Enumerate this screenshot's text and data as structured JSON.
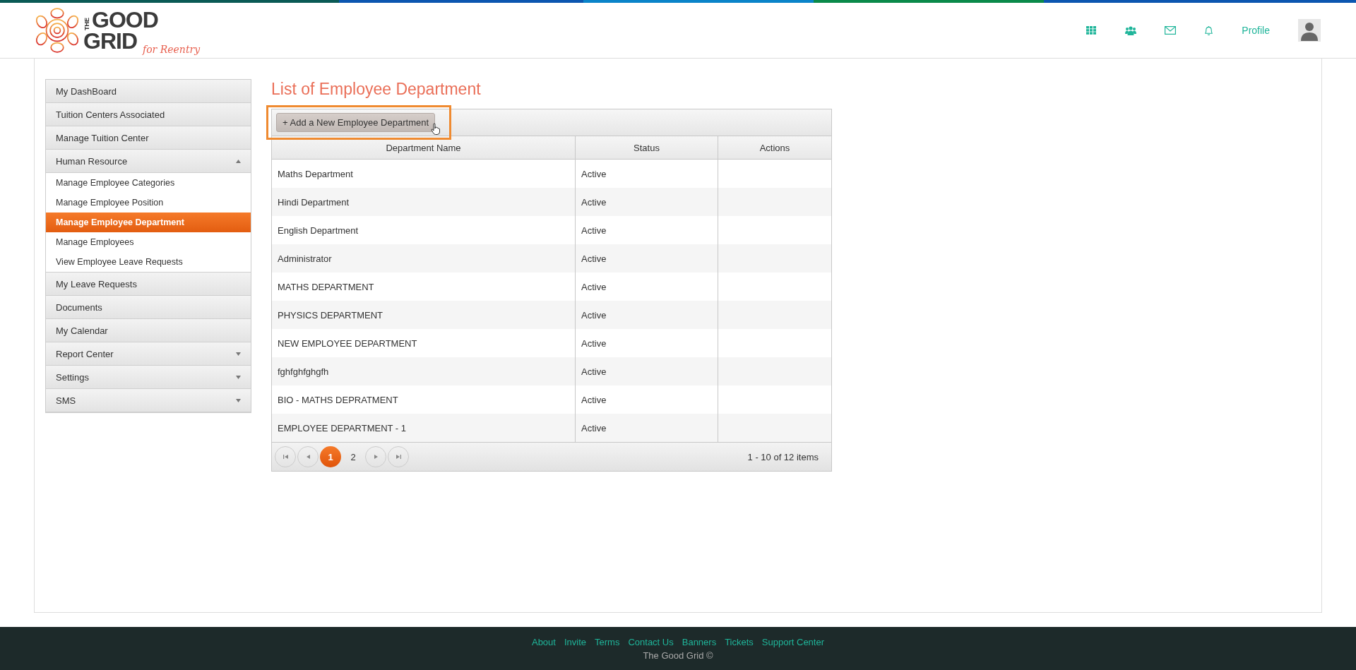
{
  "logo": {
    "word_top": "THE",
    "word_good": "GOOD",
    "word_grid": "GRID",
    "tagline": "for Reentry"
  },
  "header": {
    "profile_link": "Profile"
  },
  "sidebar": {
    "items": [
      {
        "label": "My DashBoard",
        "kind": "link"
      },
      {
        "label": "Tuition Centers Associated",
        "kind": "link"
      },
      {
        "label": "Manage Tuition Center",
        "kind": "link"
      },
      {
        "label": "Human Resource",
        "kind": "group",
        "expanded": true,
        "children": [
          {
            "label": "Manage Employee Categories",
            "selected": false
          },
          {
            "label": "Manage Employee Position",
            "selected": false
          },
          {
            "label": "Manage Employee Department",
            "selected": true
          },
          {
            "label": "Manage Employees",
            "selected": false
          },
          {
            "label": "View Employee Leave Requests",
            "selected": false
          }
        ]
      },
      {
        "label": "My Leave Requests",
        "kind": "link"
      },
      {
        "label": "Documents",
        "kind": "link"
      },
      {
        "label": "My Calendar",
        "kind": "link"
      },
      {
        "label": "Report Center",
        "kind": "group",
        "expanded": false
      },
      {
        "label": "Settings",
        "kind": "group",
        "expanded": false
      },
      {
        "label": "SMS",
        "kind": "group",
        "expanded": false
      }
    ]
  },
  "page_title": "List of Employee Department",
  "toolbar": {
    "add_button": {
      "icon": "+",
      "label": "Add a New Employee Department",
      "highlighted": true
    }
  },
  "table": {
    "columns": [
      "Department Name",
      "Status",
      "Actions"
    ],
    "rows": [
      {
        "name": "Maths Department",
        "status": "Active"
      },
      {
        "name": "Hindi Department",
        "status": "Active"
      },
      {
        "name": "English Department",
        "status": "Active"
      },
      {
        "name": "Administrator",
        "status": "Active"
      },
      {
        "name": "MATHS DEPARTMENT",
        "status": "Active"
      },
      {
        "name": "PHYSICS DEPARTMENT",
        "status": "Active"
      },
      {
        "name": "NEW EMPLOYEE DEPARTMENT",
        "status": "Active"
      },
      {
        "name": "fghfghfghgfh",
        "status": "Active"
      },
      {
        "name": "BIO - MATHS DEPRATMENT",
        "status": "Active"
      },
      {
        "name": "EMPLOYEE DEPARTMENT - 1",
        "status": "Active"
      }
    ]
  },
  "pager": {
    "pages": [
      {
        "label": "1",
        "selected": true
      },
      {
        "label": "2",
        "selected": false
      }
    ],
    "summary": "1 - 10 of 12 items"
  },
  "footer": {
    "links": [
      "About",
      "Invite",
      "Terms",
      "Contact Us",
      "Banners",
      "Tickets",
      "Support Center"
    ],
    "copyright": "The Good Grid ©"
  }
}
